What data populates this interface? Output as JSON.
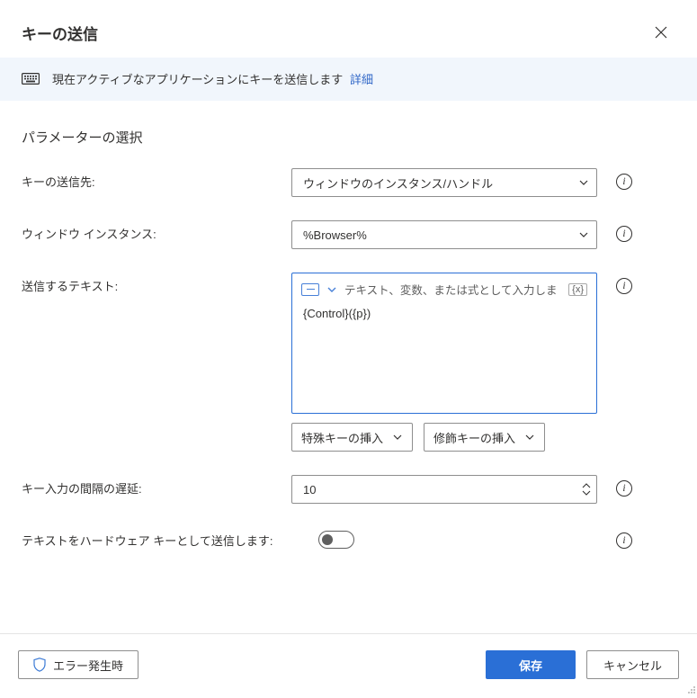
{
  "header": {
    "title": "キーの送信"
  },
  "banner": {
    "text": "現在アクティブなアプリケーションにキーを送信します",
    "link": "詳細"
  },
  "section_title": "パラメーターの選択",
  "fields": {
    "send_to": {
      "label": "キーの送信先:",
      "value": "ウィンドウのインスタンス/ハンドル"
    },
    "window_instance": {
      "label": "ウィンドウ インスタンス:",
      "value": "%Browser%"
    },
    "text_to_send": {
      "label": "送信するテキスト:",
      "placeholder": "テキスト、変数、または式として入力しま",
      "var_token": "{x}",
      "value": "{Control}({p})",
      "insert_special": "特殊キーの挿入",
      "insert_modifier": "修飾キーの挿入"
    },
    "delay": {
      "label": "キー入力の間隔の遅延:",
      "value": "10"
    },
    "hardware": {
      "label": "テキストをハードウェア キーとして送信します:",
      "on": false
    }
  },
  "footer": {
    "on_error": "エラー発生時",
    "save": "保存",
    "cancel": "キャンセル"
  }
}
